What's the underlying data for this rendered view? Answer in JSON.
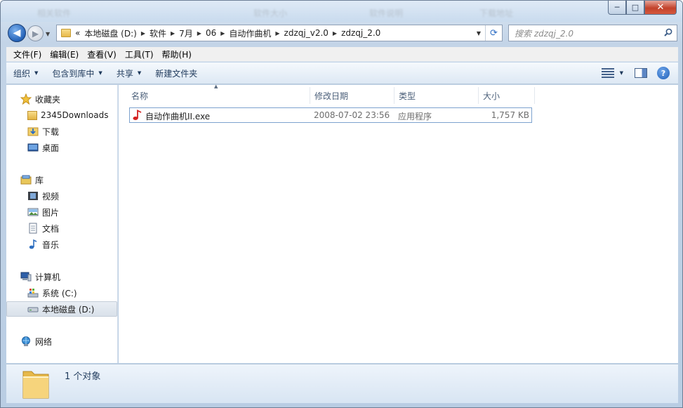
{
  "titlebar": {
    "ghost_texts": [
      "相关软件",
      "软件大小",
      "软件说明",
      "下载地址"
    ],
    "minimize": "─",
    "maximize": "□",
    "close": "✕"
  },
  "nav": {
    "back": "◀",
    "forward": "▶",
    "breadcrumbs": [
      "«",
      "本地磁盘 (D:)",
      "软件",
      "7月",
      "06",
      "自动作曲机",
      "zdzqj_v2.0",
      "zdzqj_2.0"
    ],
    "search_placeholder": "搜索 zdzqj_2.0"
  },
  "menu": [
    "文件(F)",
    "编辑(E)",
    "查看(V)",
    "工具(T)",
    "帮助(H)"
  ],
  "commands": {
    "organize": "组织",
    "include_in_library": "包含到库中",
    "share": "共享",
    "new_folder": "新建文件夹"
  },
  "sidebar": {
    "favorites": {
      "label": "收藏夹",
      "items": [
        "2345Downloads",
        "下载",
        "桌面"
      ]
    },
    "libraries": {
      "label": "库",
      "items": [
        "视频",
        "图片",
        "文档",
        "音乐"
      ]
    },
    "computer": {
      "label": "计算机",
      "items": [
        "系统 (C:)",
        "本地磁盘 (D:)"
      ],
      "selected": "本地磁盘 (D:)"
    },
    "network": {
      "label": "网络"
    }
  },
  "columns": {
    "name": "名称",
    "modified": "修改日期",
    "type": "类型",
    "size": "大小"
  },
  "files": [
    {
      "name": "自动作曲机II.exe",
      "modified": "2008-07-02 23:56",
      "type": "应用程序",
      "size": "1,757 KB",
      "icon": "music-note-icon"
    }
  ],
  "status": {
    "count": "1 个对象"
  }
}
